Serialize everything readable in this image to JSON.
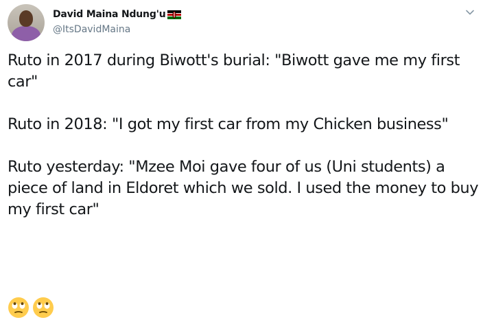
{
  "author": {
    "display_name": "David Maina Ndung'u",
    "handle": "@ItsDavidMaina",
    "flag_icon": "kenya-flag-icon"
  },
  "tweet": {
    "paragraphs": [
      "Ruto in 2017 during Biwott's burial: \"Biwott gave me my first car\"",
      "Ruto in 2018: \"I got my first car from my Chicken business\"",
      "Ruto yesterday: \"Mzee Moi gave four of us (Uni students) a piece of land in Eldoret which we sold. I used the money to buy my first car\""
    ],
    "emojis": [
      "face-with-rolling-eyes",
      "face-with-rolling-eyes"
    ]
  },
  "menu": {
    "icon": "chevron-down-icon"
  }
}
